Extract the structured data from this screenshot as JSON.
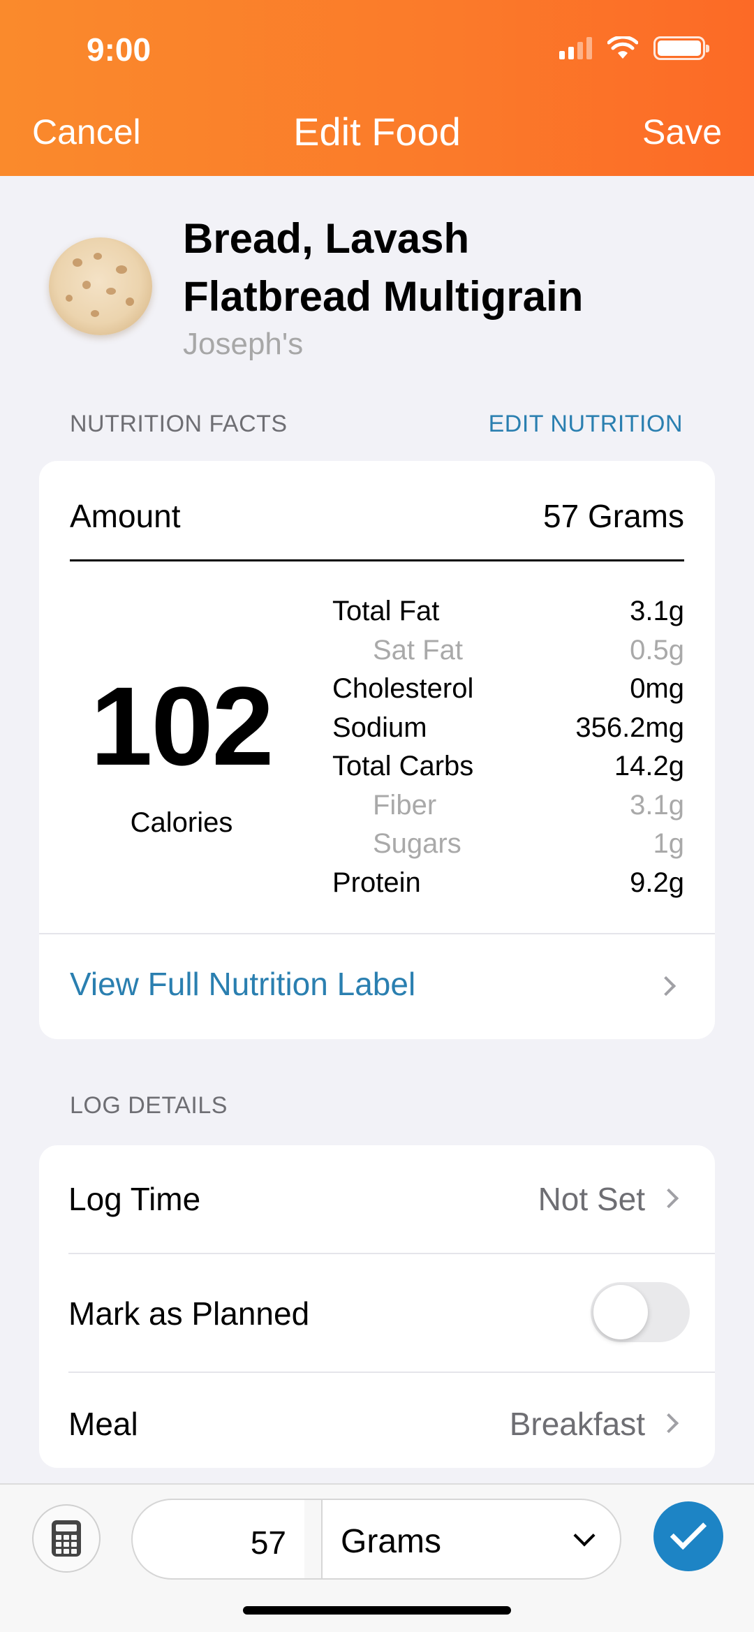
{
  "status_bar": {
    "time": "9:00"
  },
  "nav": {
    "cancel_label": "Cancel",
    "title": "Edit Food",
    "save_label": "Save"
  },
  "food": {
    "name_line1": "Bread, Lavash",
    "name_line2": "Flatbread Multigrain",
    "brand": "Joseph's",
    "image_icon": "flatbread-image"
  },
  "nutrition_section": {
    "label": "NUTRITION FACTS",
    "edit_label": "EDIT NUTRITION"
  },
  "nutrition": {
    "amount_label": "Amount",
    "amount_value": "57 Grams",
    "calories_value": "102",
    "calories_label": "Calories",
    "nutrients": [
      {
        "name": "Total Fat",
        "value": "3.1g",
        "sub": false
      },
      {
        "name": "Sat Fat",
        "value": "0.5g",
        "sub": true
      },
      {
        "name": "Cholesterol",
        "value": "0mg",
        "sub": false
      },
      {
        "name": "Sodium",
        "value": "356.2mg",
        "sub": false
      },
      {
        "name": "Total Carbs",
        "value": "14.2g",
        "sub": false
      },
      {
        "name": "Fiber",
        "value": "3.1g",
        "sub": true
      },
      {
        "name": "Sugars",
        "value": "1g",
        "sub": true
      },
      {
        "name": "Protein",
        "value": "9.2g",
        "sub": false
      }
    ],
    "full_label_link": "View Full Nutrition Label"
  },
  "log_section": {
    "label": "LOG DETAILS"
  },
  "log_details": {
    "log_time_label": "Log Time",
    "log_time_value": "Not Set",
    "planned_label": "Mark as Planned",
    "planned_on": false,
    "meal_label": "Meal",
    "meal_value": "Breakfast"
  },
  "bottom_bar": {
    "quantity": "57",
    "unit": "Grams",
    "calculator_icon": "calculator-icon",
    "confirm_icon": "checkmark-icon"
  },
  "colors": {
    "header_start": "#fa8a2c",
    "header_end": "#fc6a26",
    "link": "#2a7fb0",
    "confirm": "#1d84c5"
  }
}
